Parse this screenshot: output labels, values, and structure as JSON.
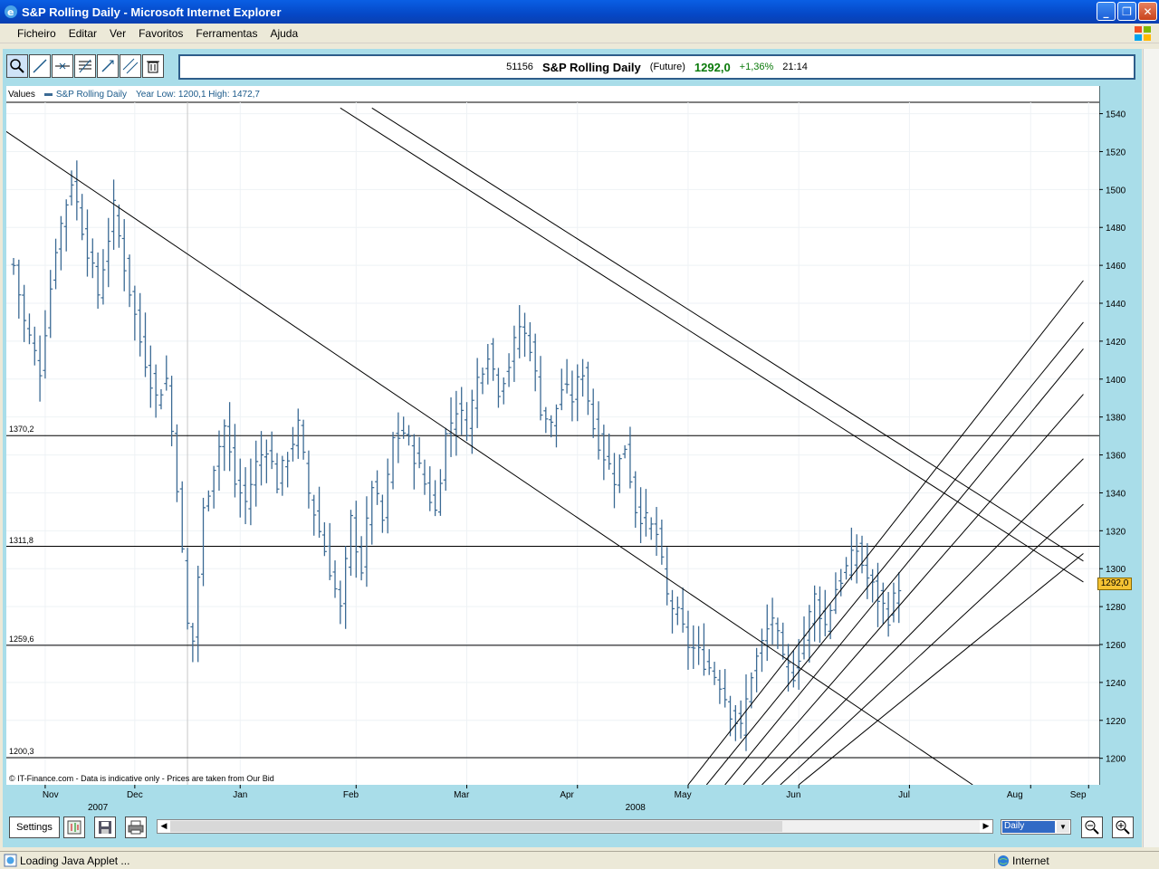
{
  "window": {
    "title": "S&P Rolling Daily - Microsoft Internet Explorer"
  },
  "menu": [
    "Ficheiro",
    "Editar",
    "Ver",
    "Favoritos",
    "Ferramentas",
    "Ajuda"
  ],
  "toolbar": {
    "tools": [
      "zoom-tool-icon",
      "trendline-tool-icon",
      "horizontal-line-tool-icon",
      "fibonacci-tool-icon",
      "arrows-tool-icon",
      "parallel-channel-tool-icon",
      "trash-icon"
    ]
  },
  "instrument": {
    "code": "51156",
    "name": "S&P Rolling Daily",
    "type": "(Future)",
    "price": "1292,0",
    "change": "+1,36%",
    "time": "21:14"
  },
  "legend": {
    "label": "Values",
    "series": "S&P Rolling Daily",
    "range": "Year Low: 1200,1 High: 1472,7"
  },
  "copyright": "© IT-Finance.com - Data is indicative only - Prices are taken from Our Bid",
  "last_price_label": "1292,0",
  "bottom": {
    "settings": "Settings",
    "period": "Daily"
  },
  "status": {
    "text": "Loading Java Applet ...",
    "zone": "Internet"
  },
  "colors": {
    "bars": "#3b6a94",
    "accent": "#a9dde9",
    "last_price_bg": "#f5c233",
    "up": "#0a7a0a"
  },
  "chart_data": {
    "type": "ohlc",
    "y_ticks": [
      "1540",
      "1520",
      "1500",
      "1480",
      "1460",
      "1440",
      "1420",
      "1400",
      "1380",
      "1360",
      "1340",
      "1320",
      "1300",
      "1280",
      "1260",
      "1240",
      "1220",
      "1200"
    ],
    "ylim": [
      1186,
      1546
    ],
    "months": [
      "Nov",
      "Dec",
      "Jan",
      "Feb",
      "Mar",
      "Apr",
      "May",
      "Jun",
      "Jul",
      "Aug",
      "Sep"
    ],
    "years": [
      "2007",
      "2008"
    ],
    "horizontal_levels": [
      {
        "label": "1370,2",
        "value": 1370.2
      },
      {
        "label": "1311,8",
        "value": 1311.8
      },
      {
        "label": "1259,6",
        "value": 1259.6
      },
      {
        "label": "1200,3",
        "value": 1200.3
      }
    ],
    "close_path": [
      [
        0,
        1460
      ],
      [
        2,
        1430
      ],
      [
        5,
        1405
      ],
      [
        8,
        1470
      ],
      [
        11,
        1505
      ],
      [
        13,
        1480
      ],
      [
        16,
        1445
      ],
      [
        19,
        1490
      ],
      [
        21,
        1460
      ],
      [
        24,
        1420
      ],
      [
        27,
        1390
      ],
      [
        29,
        1400
      ],
      [
        31,
        1345
      ],
      [
        33,
        1270
      ],
      [
        34,
        1262
      ],
      [
        36,
        1330
      ],
      [
        38,
        1355
      ],
      [
        40,
        1375
      ],
      [
        42,
        1345
      ],
      [
        44,
        1335
      ],
      [
        46,
        1355
      ],
      [
        48,
        1365
      ],
      [
        50,
        1345
      ],
      [
        52,
        1360
      ],
      [
        54,
        1375
      ],
      [
        56,
        1340
      ],
      [
        58,
        1320
      ],
      [
        60,
        1300
      ],
      [
        62,
        1278
      ],
      [
        64,
        1325
      ],
      [
        66,
        1300
      ],
      [
        68,
        1345
      ],
      [
        70,
        1325
      ],
      [
        72,
        1368
      ],
      [
        74,
        1372
      ],
      [
        76,
        1360
      ],
      [
        78,
        1345
      ],
      [
        80,
        1330
      ],
      [
        82,
        1370
      ],
      [
        84,
        1385
      ],
      [
        86,
        1375
      ],
      [
        88,
        1400
      ],
      [
        90,
        1415
      ],
      [
        92,
        1395
      ],
      [
        94,
        1408
      ],
      [
        96,
        1428
      ],
      [
        98,
        1418
      ],
      [
        100,
        1385
      ],
      [
        102,
        1375
      ],
      [
        104,
        1395
      ],
      [
        106,
        1390
      ],
      [
        108,
        1405
      ],
      [
        110,
        1375
      ],
      [
        112,
        1360
      ],
      [
        114,
        1348
      ],
      [
        116,
        1365
      ],
      [
        118,
        1332
      ],
      [
        120,
        1325
      ],
      [
        122,
        1318
      ],
      [
        124,
        1285
      ],
      [
        126,
        1275
      ],
      [
        128,
        1260
      ],
      [
        130,
        1255
      ],
      [
        132,
        1248
      ],
      [
        134,
        1240
      ],
      [
        136,
        1225
      ],
      [
        138,
        1215
      ],
      [
        140,
        1245
      ],
      [
        142,
        1260
      ],
      [
        144,
        1275
      ],
      [
        146,
        1250
      ],
      [
        148,
        1245
      ],
      [
        150,
        1265
      ],
      [
        152,
        1285
      ],
      [
        154,
        1270
      ],
      [
        156,
        1290
      ],
      [
        158,
        1300
      ],
      [
        160,
        1310
      ],
      [
        162,
        1295
      ],
      [
        164,
        1285
      ],
      [
        166,
        1275
      ],
      [
        168,
        1292
      ]
    ],
    "trendlines": [
      {
        "x1": -8,
        "y1": 1543,
        "x2": 182,
        "y2": 1186
      },
      {
        "x1": 62,
        "y1": 1543,
        "x2": 203,
        "y2": 1293
      },
      {
        "x1": 68,
        "y1": 1543,
        "x2": 203,
        "y2": 1304
      }
    ],
    "channel": {
      "x_start": 128,
      "x_end": 203,
      "y_start": 1186,
      "y_ends": [
        1452,
        1430,
        1416,
        1392,
        1358,
        1334,
        1308
      ]
    }
  }
}
